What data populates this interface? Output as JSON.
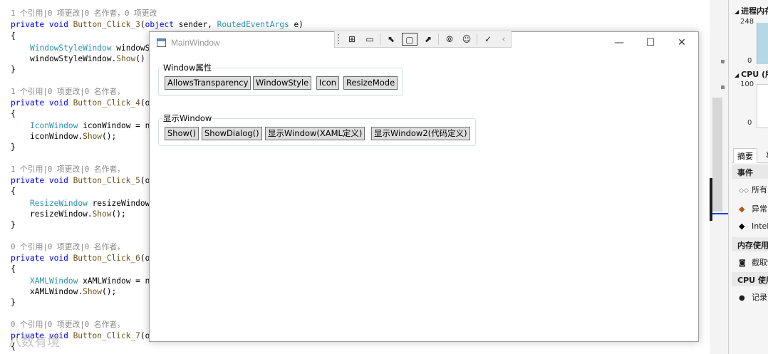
{
  "editor": {
    "lines": [
      {
        "codelens": "1 个引用|0 项更改|0 名作者，0 项更改"
      },
      {
        "kw": "private void ",
        "fn": "Button_Click_3",
        "rest1": "(",
        "kw2": "object",
        "rest2": " sender, ",
        "ty": "RoutedEventArgs",
        "rest3": " e)"
      },
      {
        "text": "{"
      },
      {
        "ty": "WindowStyleWindow",
        "rest": " windowS"
      },
      {
        "rest": "windowStyleWindow.",
        "fn": "Show",
        "rest2": "()"
      },
      {
        "text": "}"
      },
      {
        "codelens": "1 个引用|0 项更改|0 名作者，"
      },
      {
        "kw": "private void ",
        "fn": "Button_Click_4",
        "rest1": "(o"
      },
      {
        "text": "{"
      },
      {
        "ty": "IconWindow",
        "rest": " iconWindow = n"
      },
      {
        "rest": "iconWindow.",
        "fn": "Show",
        "rest2": "();"
      },
      {
        "text": "}"
      },
      {
        "codelens": "1 个引用|0 项更改|0 名作者，"
      },
      {
        "kw": "private void ",
        "fn": "Button_Click_5",
        "rest1": "(o"
      },
      {
        "text": "{"
      },
      {
        "ty": "ResizeWindow",
        "rest": " resizeWindow"
      },
      {
        "rest": "resizeWindow.",
        "fn": "Show",
        "rest2": "();"
      },
      {
        "text": "}"
      },
      {
        "codelens": "0 个引用|0 项更改|0 名作者，"
      },
      {
        "kw": "private void ",
        "fn": "Button_Click_6",
        "rest1": "(o"
      },
      {
        "text": "{"
      },
      {
        "ty": "XAMLWindow",
        "rest": " xAMLWindow = n"
      },
      {
        "rest": "xAMLWindow.",
        "fn": "Show",
        "rest2": "();"
      },
      {
        "text": "}"
      },
      {
        "codelens": "0 个引用|0 项更改|0 名作者，"
      },
      {
        "kw": "private void ",
        "fn": "Button_Click_7",
        "rest1": "(o"
      },
      {
        "text": "{"
      }
    ]
  },
  "diagnostics": {
    "memory_header": "进程内存",
    "memory_max": "248",
    "memory_min": "0",
    "cpu_header": "CPU (所有",
    "cpu_max": "100",
    "cpu_min": "0",
    "tab_summary": "摘要",
    "tab_events": "事件",
    "events_section": "事件",
    "event_all": "所有",
    "event_exceptions": "异常",
    "event_intellitrace": "IntelliTrace",
    "memory_section": "内存使用率",
    "snapshot": "截取快照",
    "cpu_section": "CPU 使用率",
    "record": "记录 CPU"
  },
  "window": {
    "title": "MainWindow",
    "minimize_glyph": "—",
    "maximize_glyph": "☐",
    "close_glyph": "✕",
    "toolbar": {
      "icons": [
        "select-element-icon",
        "display-adorners-icon",
        "track-focus-icon",
        "show-layout-icon",
        "hot-reload-icon",
        "accessibility-icon",
        "binding-failures-icon",
        "collapse-icon"
      ]
    },
    "group1": {
      "header": "Window属性",
      "buttons": [
        "AllowsTransparency",
        "WindowStyle",
        "Icon",
        "ResizeMode"
      ]
    },
    "group2": {
      "header": "显示Window",
      "buttons": [
        "Show()",
        "ShowDialog()",
        "显示Window(XAML定义)",
        "显示Window2(代码定义)"
      ]
    }
  },
  "watermark": "八数有境"
}
